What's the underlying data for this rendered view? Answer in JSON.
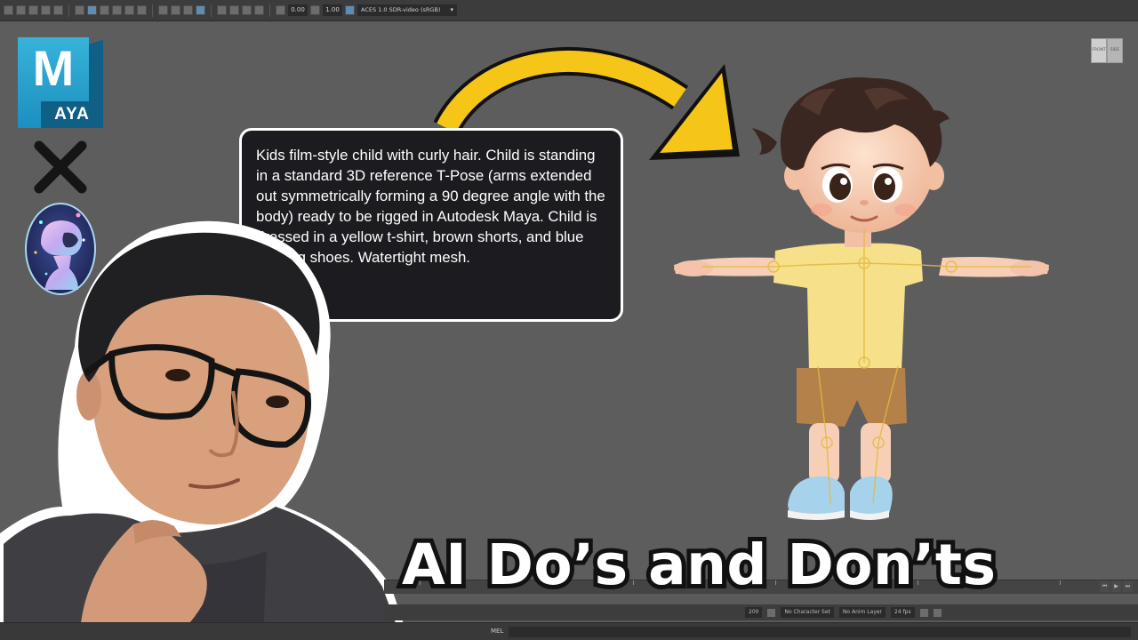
{
  "toolbar": {
    "exposure_value": "0.00",
    "gamma_value": "1.00",
    "color_space": "ACES 1.0 SDR-video (sRGB)"
  },
  "viewcube": {
    "front_label": "FRONT",
    "side_label": "SIDE"
  },
  "logos": {
    "maya_letter": "M",
    "maya_word": "AYA",
    "separator_icon": "x-icon",
    "ai_icon": "ai-robot-avatar-icon"
  },
  "prompt_bubble": {
    "text": "Kids film-style child with curly hair. Child is standing in a standard 3D reference T-Pose (arms extended out symmetrically forming a 90 degree angle with the body) ready to be rigged in Autodesk Maya. Child is dressed in a yellow t-shirt, brown shorts, and blue running shoes. Watertight mesh."
  },
  "headline": "AI Do’s and Don’ts",
  "timeline": {
    "end_frame": "200",
    "character_set": "No Character Set",
    "anim_layer": "No Anim Layer",
    "fps": "24 fps"
  },
  "command_line": {
    "label": "MEL"
  },
  "colors": {
    "accent_yellow": "#f5c518",
    "bubble_bg": "#1c1c20",
    "viewport_bg": "#5d5d5d",
    "maya_blue": "#1c8fc0",
    "shirt_yellow": "#f6e08a"
  }
}
